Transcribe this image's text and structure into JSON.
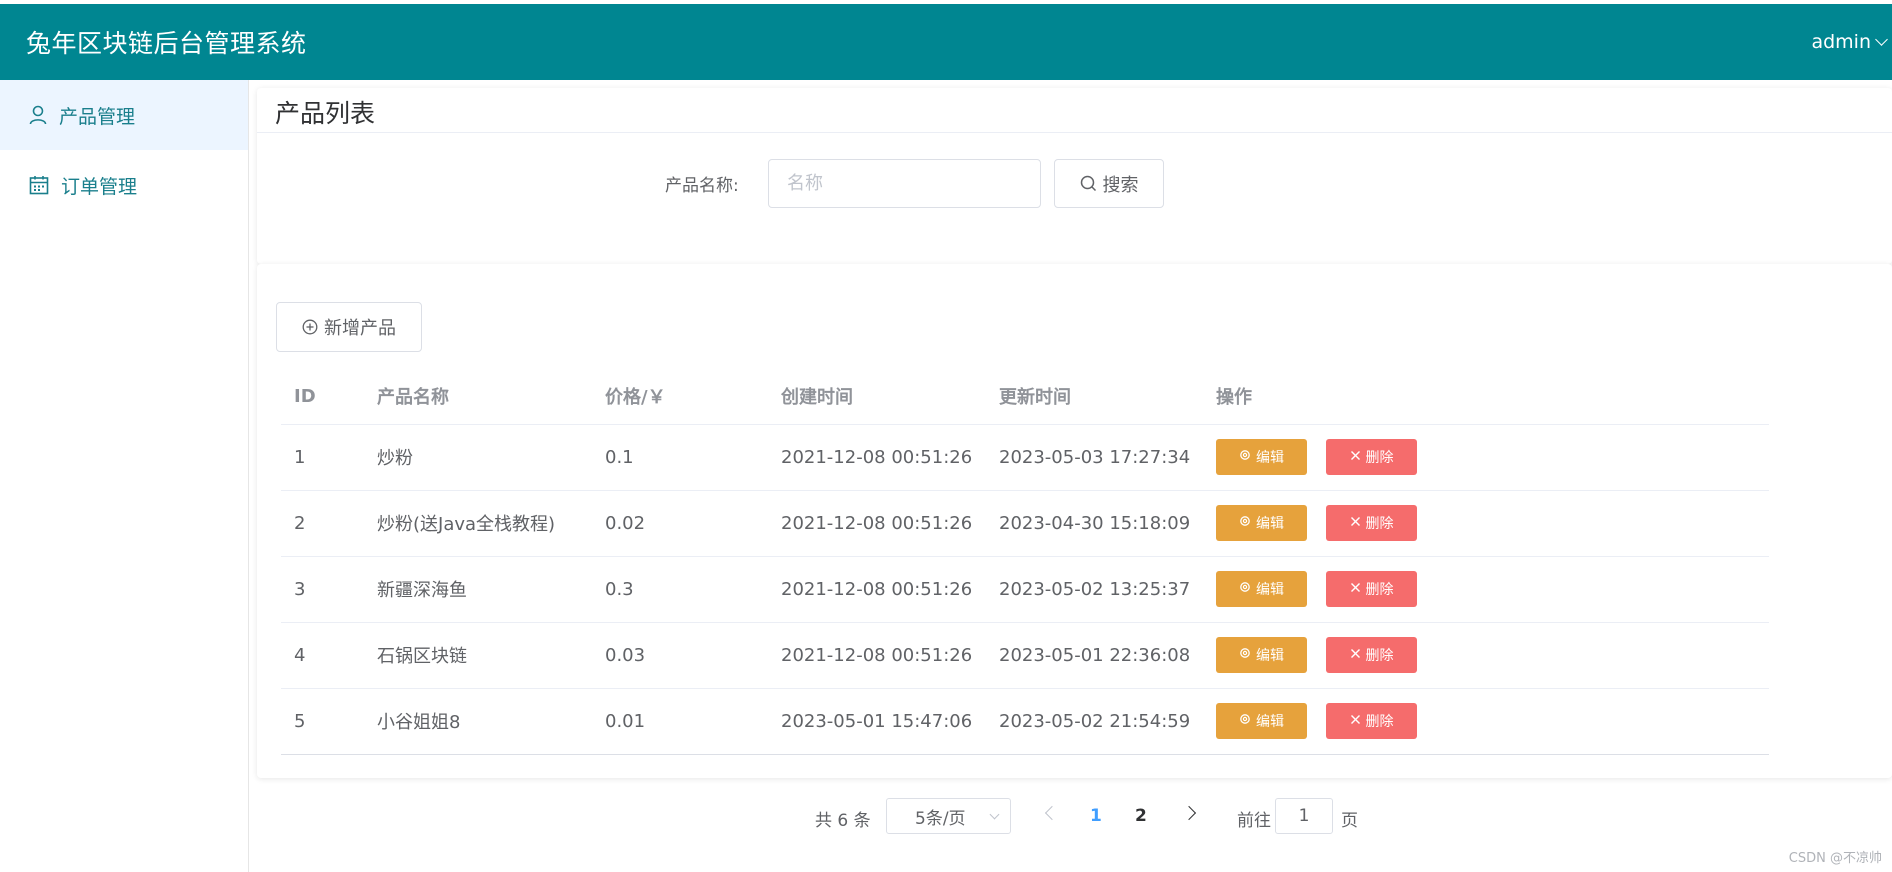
{
  "header": {
    "title": "兔年区块链后台管理系统",
    "user": "admin"
  },
  "sidebar": {
    "items": [
      {
        "label": "产品管理",
        "icon": "user-icon",
        "active": true
      },
      {
        "label": "订单管理",
        "icon": "calendar-icon",
        "active": false
      }
    ]
  },
  "main": {
    "page_title": "产品列表",
    "search": {
      "label": "产品名称:",
      "placeholder": "名称",
      "value": "",
      "button": "搜索"
    },
    "add_button": "新增产品",
    "table": {
      "columns": [
        "ID",
        "产品名称",
        "价格/￥",
        "创建时间",
        "更新时间",
        "操作"
      ],
      "rows": [
        {
          "id": "1",
          "name": "炒粉",
          "price": "0.1",
          "created": "2021-12-08 00:51:26",
          "updated": "2023-05-03 17:27:34"
        },
        {
          "id": "2",
          "name": "炒粉(送Java全栈教程)",
          "price": "0.02",
          "created": "2021-12-08 00:51:26",
          "updated": "2023-04-30 15:18:09"
        },
        {
          "id": "3",
          "name": "新疆深海鱼",
          "price": "0.3",
          "created": "2021-12-08 00:51:26",
          "updated": "2023-05-02 13:25:37"
        },
        {
          "id": "4",
          "name": "石锅区块链",
          "price": "0.03",
          "created": "2021-12-08 00:51:26",
          "updated": "2023-05-01 22:36:08"
        },
        {
          "id": "5",
          "name": "小谷姐姐8",
          "price": "0.01",
          "created": "2023-05-01 15:47:06",
          "updated": "2023-05-02 21:54:59"
        }
      ],
      "edit_label": "编辑",
      "delete_label": "删除"
    },
    "pagination": {
      "total_text": "共 6 条",
      "page_size": "5条/页",
      "pages": [
        "1",
        "2"
      ],
      "current_page": "1",
      "goto_label": "前往",
      "goto_value": "1",
      "page_unit": "页"
    }
  },
  "watermark": "CSDN @不凉帅",
  "colors": {
    "header_bg": "#008691",
    "accent": "#1a7f8c",
    "edit": "#e6a23c",
    "delete": "#f56c6c",
    "page_active": "#409eff"
  }
}
